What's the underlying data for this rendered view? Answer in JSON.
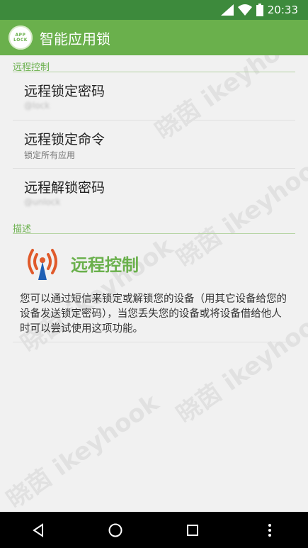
{
  "status_bar": {
    "time": "20:33"
  },
  "app_bar": {
    "title": "智能应用锁",
    "logo_text": "APP LOCK"
  },
  "sections": {
    "remote_control": {
      "header": "远程控制",
      "items": [
        {
          "title": "远程锁定密码",
          "summary": "@lock"
        },
        {
          "title": "远程锁定命令",
          "summary": "锁定所有应用"
        },
        {
          "title": "远程解锁密码",
          "summary": "@unlock"
        }
      ]
    },
    "description": {
      "header": "描述",
      "title": "远程控制",
      "text": "您可以通过短信来锁定或解锁您的设备（用其它设备给您的设备发送锁定密码），当您丢失您的设备或将设备借给他人时可以尝试使用这项功能。"
    }
  },
  "watermark": "晓茵 ikeyhook",
  "colors": {
    "statusbar": "#3d8a3c",
    "appbar": "#6ab04c",
    "accent": "#6ab04c",
    "antenna_red": "#e05a2b",
    "antenna_blue": "#1e5fb4"
  }
}
